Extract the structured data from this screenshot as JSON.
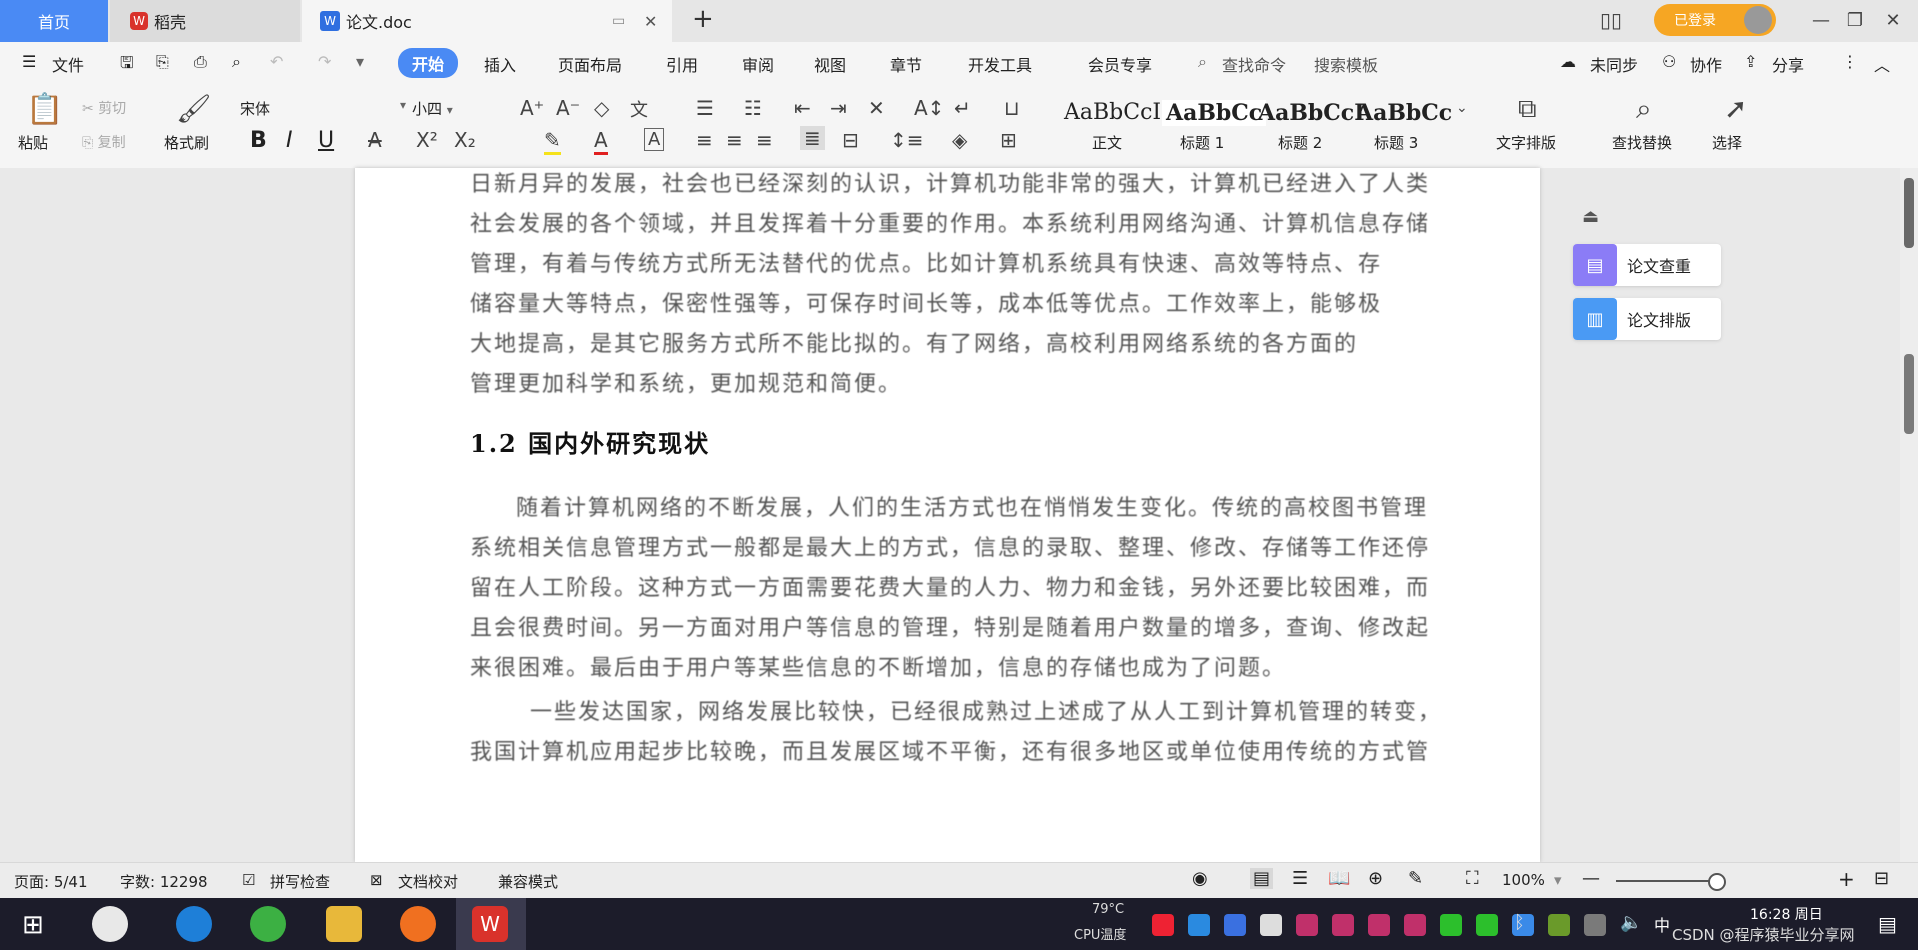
{
  "titlebar": {
    "tab_home": "首页",
    "tab_daoke": "稻壳",
    "tab_doc": "论文.doc",
    "login_button": "已登录"
  },
  "menubar": {
    "file": "文件",
    "items": [
      "开始",
      "插入",
      "页面布局",
      "引用",
      "审阅",
      "视图",
      "章节",
      "开发工具",
      "会员专享"
    ],
    "search_cmd": "查找命令",
    "search_template": "搜索模板",
    "not_synced": "未同步",
    "collaborate": "协作",
    "share": "分享"
  },
  "ribbon": {
    "paste": "粘贴",
    "cut": "剪切",
    "copy": "复制",
    "format_painter": "格式刷",
    "font_name": "宋体",
    "font_size": "小四",
    "styles": [
      {
        "preview": "AaBbCcI",
        "label": "正文"
      },
      {
        "preview": "AaBbCc",
        "label": "标题 1"
      },
      {
        "preview": "AaBbCcI",
        "label": "标题 2"
      },
      {
        "preview": "AaBbCc",
        "label": "标题 3"
      }
    ],
    "text_layout": "文字排版",
    "find_replace": "查找替换",
    "select": "选择"
  },
  "document": {
    "lines_top": [
      "日新月异的发展，社会也已经深刻的认识，计算机功能非常的强大，计算机已经进入了人类",
      "社会发展的各个领域，并且发挥着十分重要的作用。本系统利用网络沟通、计算机信息存储",
      "管理，有着与传统方式所无法替代的优点。比如计算机系统具有快速、高效等特点、存",
      "储容量大等特点，保密性强等，可保存时间长等，成本低等优点。工作效率上，能够极",
      "大地提高，是其它服务方式所不能比拟的。有了网络，高校利用网络系统的各方面的",
      "管理更加科学和系统，更加规范和简便。"
    ],
    "heading": "1.2 国内外研究现状",
    "lines_bottom": [
      "随着计算机网络的不断发展，人们的生活方式也在悄悄发生变化。传统的高校图书管理",
      "系统相关信息管理方式一般都是最大上的方式，信息的录取、整理、修改、存储等工作还停",
      "留在人工阶段。这种方式一方面需要花费大量的人力、物力和金钱，另外还要比较困难，而",
      "且会很费时间。另一方面对用户等信息的管理，特别是随着用户数量的增多，查询、修改起",
      "来很困难。最后由于用户等某些信息的不断增加，信息的存储也成为了问题。",
      "一些发达国家，网络发展比较快，已经很成熟过上述成了从人工到计算机管理的转变，",
      "我国计算机应用起步比较晚，而且发展区域不平衡，还有很多地区或单位使用传统的方式管"
    ]
  },
  "side_panel": {
    "check": "论文查重",
    "layout": "论文排版"
  },
  "statusbar": {
    "page": "页面: 5/41",
    "words": "字数: 12298",
    "spell": "拼写检查",
    "proof": "文档校对",
    "compat": "兼容模式",
    "zoom": "100%"
  },
  "taskbar": {
    "cpu_temp": "79°C",
    "cpu_label": "CPU温度",
    "ime": "中",
    "time": "16:28 周日",
    "watermark": "CSDN @程序猿毕业分享网"
  },
  "colors": {
    "accent": "#4a8af4",
    "login": "#f6a623",
    "wps_red": "#d9322b",
    "check_icon": "#8b7cf6",
    "layout_icon": "#4a9af4"
  }
}
